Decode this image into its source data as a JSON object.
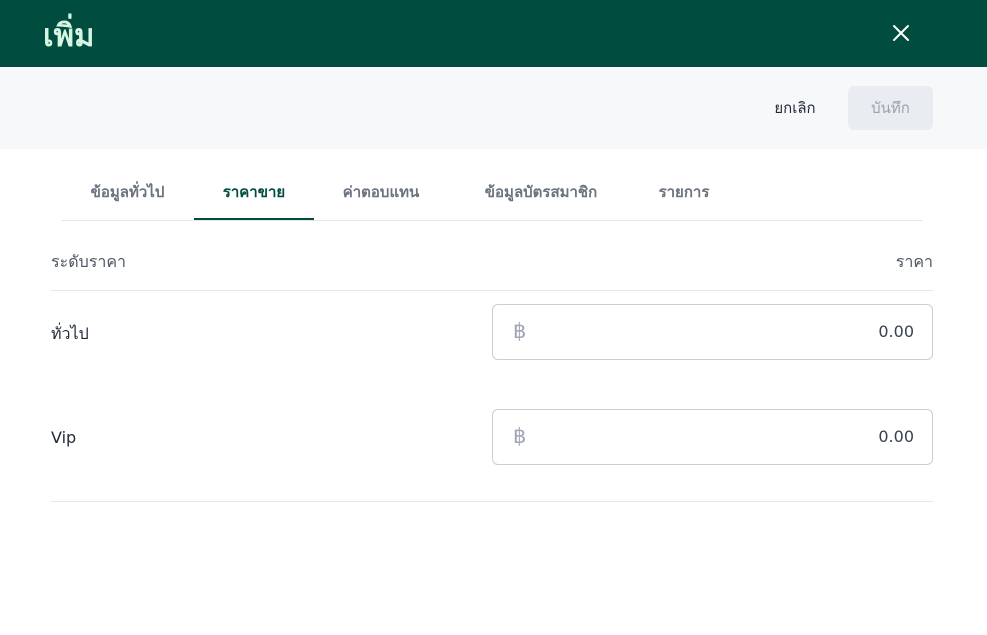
{
  "header": {
    "title": "เพิ่ม",
    "close_icon": "close-icon"
  },
  "toolbar": {
    "cancel_label": "ยกเลิก",
    "save_label": "บันทึก"
  },
  "tabs": [
    {
      "label": "ข้อมูลทั่วไป",
      "active": false
    },
    {
      "label": "ราคาขาย",
      "active": true
    },
    {
      "label": "ค่าตอบแทน",
      "active": false
    },
    {
      "label": "ข้อมูลบัตรสมาชิก",
      "active": false
    },
    {
      "label": "รายการ",
      "active": false
    }
  ],
  "table": {
    "col_level": "ระดับราคา",
    "col_price": "ราคา",
    "rows": [
      {
        "label": "ทั่วไป",
        "currency": "฿",
        "value": "0.00"
      },
      {
        "label": "Vip",
        "currency": "฿",
        "value": "0.00"
      }
    ]
  },
  "colors": {
    "header_bg": "#004d40",
    "header_title": "#d6f5e3",
    "accent": "#004d40",
    "toolbar_bg": "#f7f8fa"
  }
}
